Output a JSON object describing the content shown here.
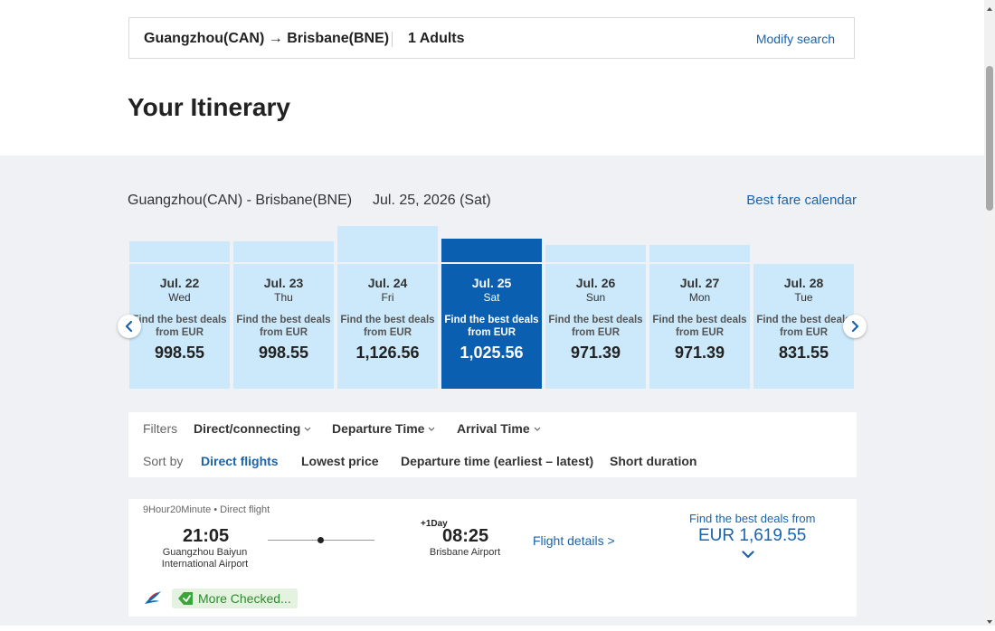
{
  "search_bar": {
    "route": "Guangzhou(CAN) → Brisbane(BNE)",
    "passengers": "1 Adults",
    "modify_label": "Modify search"
  },
  "page_title": "Your Itinerary",
  "trip": {
    "route": "Guangzhou(CAN) - Brisbane(BNE)",
    "date": "Jul. 25, 2026 (Sat)",
    "calendar_link": "Best fare calendar"
  },
  "date_carousel": {
    "deal_text_line1": "Find the best deals",
    "deal_text_line2": "from EUR",
    "days": [
      {
        "date": "Jul. 22",
        "weekday": "Wed",
        "price": "998.55",
        "price_value": 998.55,
        "selected": false
      },
      {
        "date": "Jul. 23",
        "weekday": "Thu",
        "price": "998.55",
        "price_value": 998.55,
        "selected": false
      },
      {
        "date": "Jul. 24",
        "weekday": "Fri",
        "price": "1,126.56",
        "price_value": 1126.56,
        "selected": false
      },
      {
        "date": "Jul. 25",
        "weekday": "Sat",
        "price": "1,025.56",
        "price_value": 1025.56,
        "selected": true
      },
      {
        "date": "Jul. 26",
        "weekday": "Sun",
        "price": "971.39",
        "price_value": 971.39,
        "selected": false
      },
      {
        "date": "Jul. 27",
        "weekday": "Mon",
        "price": "971.39",
        "price_value": 971.39,
        "selected": false
      },
      {
        "date": "Jul. 28",
        "weekday": "Tue",
        "price": "831.55",
        "price_value": 831.55,
        "selected": false
      }
    ]
  },
  "filters": {
    "label": "Filters",
    "items": [
      "Direct/connecting",
      "Departure Time",
      "Arrival Time"
    ]
  },
  "sort": {
    "label": "Sort by",
    "items": [
      "Direct flights",
      "Lowest price",
      "Departure time (earliest – latest)",
      "Short duration"
    ],
    "active_index": 0
  },
  "flight": {
    "meta": "9Hour20Minute • Direct flight",
    "departure_time": "21:05",
    "departure_airport": "Guangzhou Baiyun International Airport",
    "day_offset": "+1Day",
    "arrival_time": "08:25",
    "arrival_airport": "Brisbane Airport",
    "details_link": "Flight details >",
    "deal_text": "Find the best deals from",
    "price": "EUR 1,619.55",
    "tag": "More Checked..."
  },
  "colors": {
    "accent": "#1a63ad",
    "selected_day": "#0b5fb0",
    "day_card": "#cbe9fa",
    "section_bg": "#eff1f4",
    "tag_green": "#2f8a2f"
  },
  "icons": {
    "prev": "chevron-left-icon",
    "next": "chevron-right-icon",
    "dropdown": "chevron-down-icon",
    "airline": "airline-logo-icon",
    "tag": "checked-tag-icon"
  }
}
